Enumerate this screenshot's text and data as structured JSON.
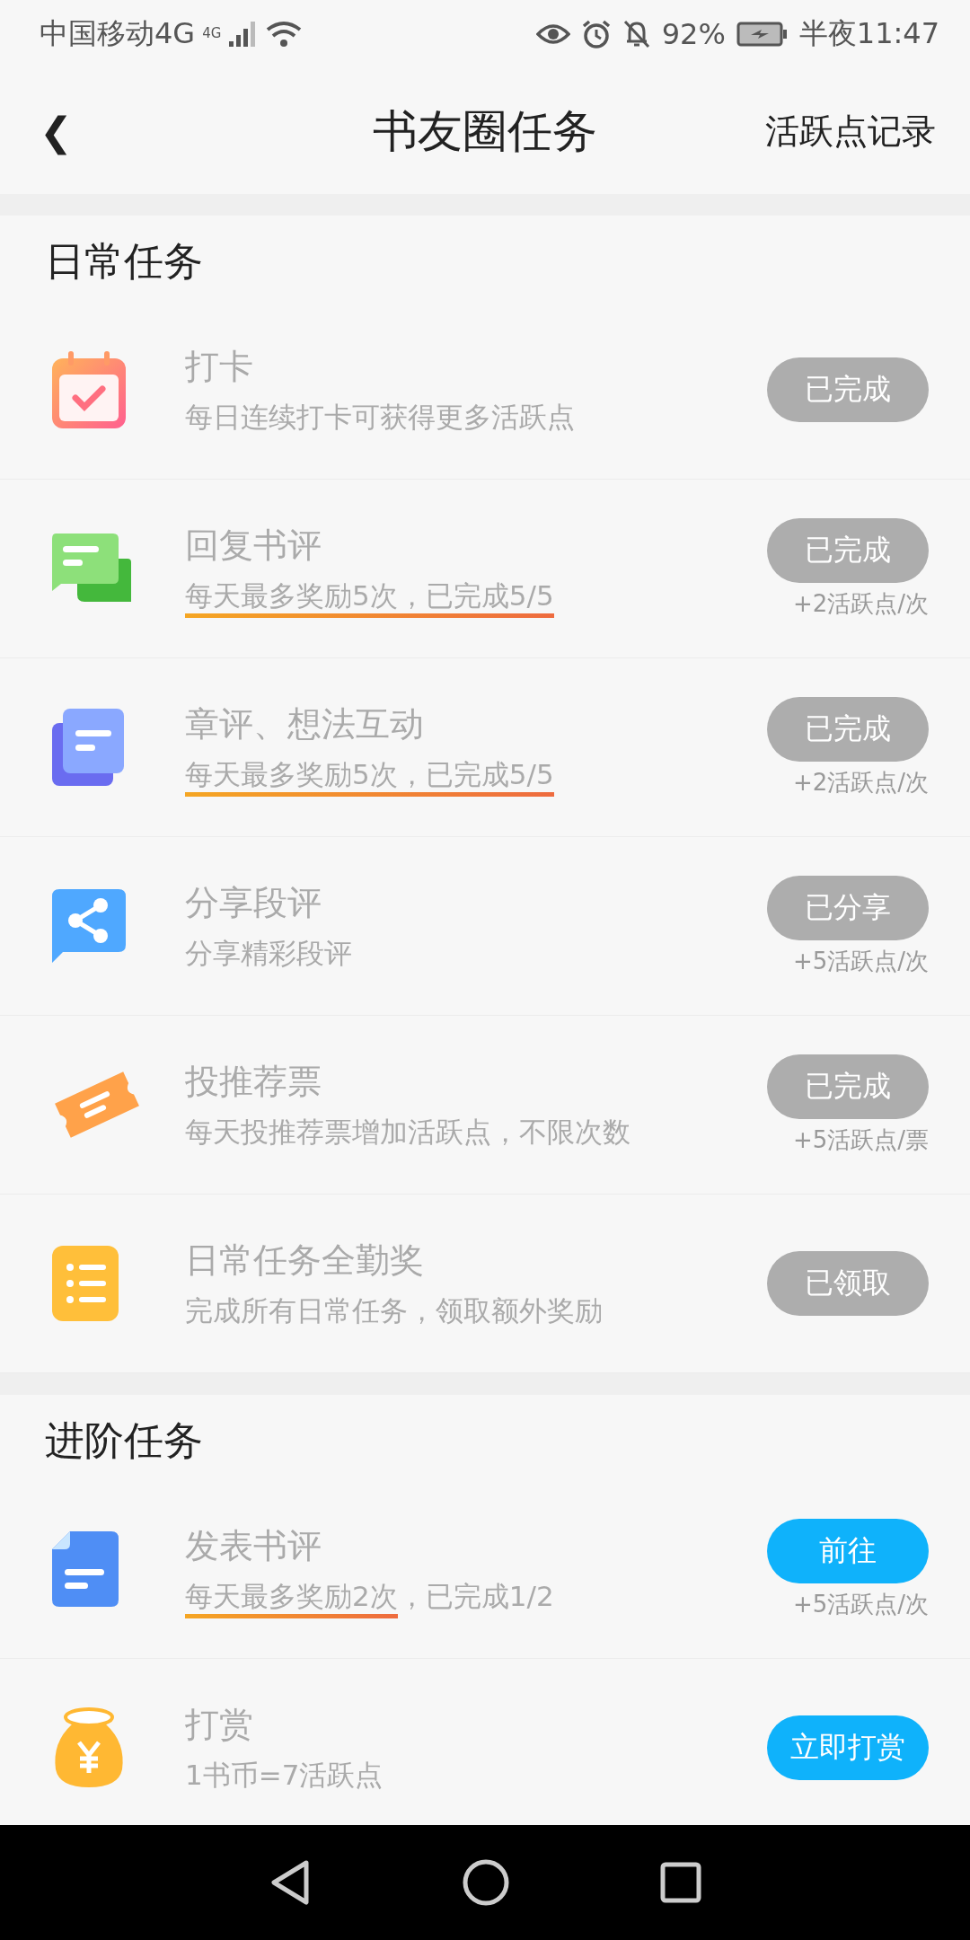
{
  "status_bar": {
    "carrier": "中国移动4G",
    "network_badge": "4G",
    "battery_percent": "92%",
    "time": "半夜11:47"
  },
  "header": {
    "back_icon": "❮",
    "title": "书友圈任务",
    "action": "活跃点记录"
  },
  "sections": [
    {
      "title": "日常任务",
      "tasks": [
        {
          "kind": "calendar",
          "title": "打卡",
          "subtitle_parts": [
            {
              "text": "每日连续打卡可获得更多活跃点",
              "underlined": false
            }
          ],
          "button": {
            "label": "已完成",
            "done": true
          }
        },
        {
          "kind": "chat",
          "title": "回复书评",
          "subtitle_parts": [
            {
              "text": "每天最多奖励5次，已完成5/5",
              "underlined": true
            }
          ],
          "button": {
            "label": "已完成",
            "done": true
          },
          "reward": "+2活跃点/次"
        },
        {
          "kind": "docs",
          "title": "章评、想法互动",
          "subtitle_parts": [
            {
              "text": "每天最多奖励5次，已完成5/5",
              "underlined": true
            }
          ],
          "button": {
            "label": "已完成",
            "done": true
          },
          "reward": "+2活跃点/次"
        },
        {
          "kind": "share",
          "title": "分享段评",
          "subtitle_parts": [
            {
              "text": "分享精彩段评",
              "underlined": false
            }
          ],
          "button": {
            "label": "已分享",
            "done": true
          },
          "reward": "+5活跃点/次"
        },
        {
          "kind": "ticket",
          "title": "投推荐票",
          "subtitle_parts": [
            {
              "text": "每天投推荐票增加活跃点，不限次数",
              "underlined": false
            }
          ],
          "button": {
            "label": "已完成",
            "done": true
          },
          "reward": "+5活跃点/票"
        },
        {
          "kind": "list",
          "title": "日常任务全勤奖",
          "subtitle_parts": [
            {
              "text": "完成所有日常任务，领取额外奖励",
              "underlined": false
            }
          ],
          "button": {
            "label": "已领取",
            "done": true
          }
        }
      ]
    },
    {
      "title": "进阶任务",
      "tasks": [
        {
          "kind": "file",
          "title": "发表书评",
          "subtitle_parts": [
            {
              "text": "每天最多奖励2次",
              "underlined": true
            },
            {
              "text": "，已完成1/2",
              "underlined": false
            }
          ],
          "button": {
            "label": "前往",
            "done": false
          },
          "reward": "+5活跃点/次"
        },
        {
          "kind": "moneybag",
          "title": "打赏",
          "subtitle_parts": [
            {
              "text": "1书币=7活跃点",
              "underlined": false
            }
          ],
          "button": {
            "label": "立即打赏",
            "done": false
          }
        }
      ]
    }
  ]
}
